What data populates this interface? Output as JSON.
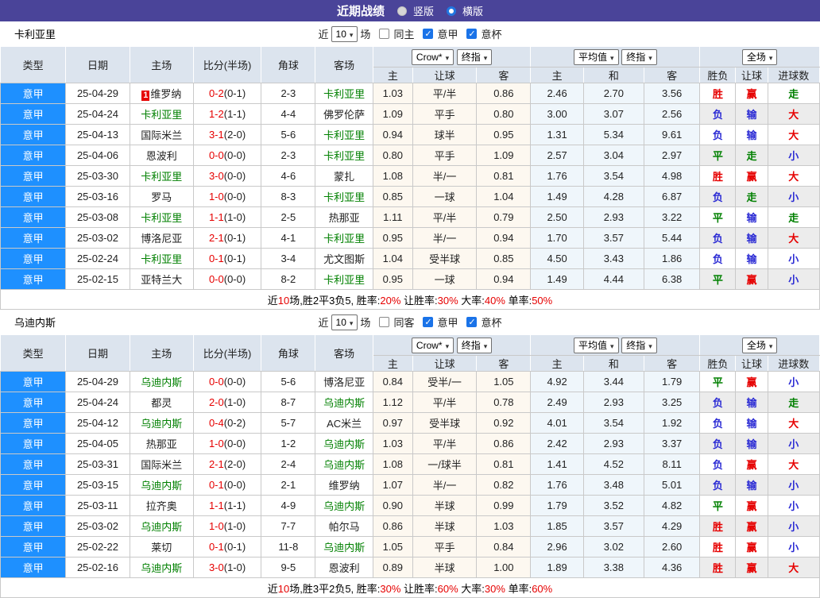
{
  "title_bar": {
    "title": "近期战绩",
    "vertical_label": "竖版",
    "horizontal_label": "横版"
  },
  "table_header": {
    "base_cols": [
      "类型",
      "日期",
      "主场",
      "比分(半场)",
      "角球",
      "客场"
    ],
    "odds_select": "Crow*",
    "odds_final_select": "终指",
    "odds_cols": [
      "主",
      "让球",
      "客"
    ],
    "avg_select": "平均值",
    "avg_final_select": "终指",
    "avg_cols": [
      "主",
      "和",
      "客"
    ],
    "full_select": "全场",
    "result_cols": [
      "胜负",
      "让球",
      "进球数"
    ]
  },
  "result_colors": {
    "胜": "red",
    "赢": "red",
    "大": "red",
    "负": "blue",
    "输": "blue",
    "小": "blue",
    "平": "green",
    "走": "green"
  },
  "row_fields": [
    "league",
    "date",
    "home",
    "home_is_team",
    "home_badge",
    "score_ft",
    "score_ht",
    "corners",
    "away",
    "away_is_team",
    "odds_home",
    "handicap",
    "odds_away",
    "avg_home",
    "avg_draw",
    "avg_away",
    "result",
    "handicap_result",
    "goals_result"
  ],
  "sections": [
    {
      "team": "卡利亚里",
      "controls": {
        "prefix": "近",
        "count": "10",
        "suffix": "场",
        "same": "同主",
        "same_checked": false,
        "league": "意甲",
        "league_checked": true,
        "cup": "意杯",
        "cup_checked": true
      },
      "rows": [
        [
          "意甲",
          "25-04-29",
          "维罗纳",
          0,
          "1",
          "0-2",
          "(0-1)",
          "2-3",
          "卡利亚里",
          1,
          "1.03",
          "平/半",
          "0.86",
          "2.46",
          "2.70",
          "3.56",
          "胜",
          "赢",
          "走"
        ],
        [
          "意甲",
          "25-04-24",
          "卡利亚里",
          1,
          "",
          "1-2",
          "(1-1)",
          "4-4",
          "佛罗伦萨",
          0,
          "1.09",
          "平手",
          "0.80",
          "3.00",
          "3.07",
          "2.56",
          "负",
          "输",
          "大"
        ],
        [
          "意甲",
          "25-04-13",
          "国际米兰",
          0,
          "",
          "3-1",
          "(2-0)",
          "5-6",
          "卡利亚里",
          1,
          "0.94",
          "球半",
          "0.95",
          "1.31",
          "5.34",
          "9.61",
          "负",
          "输",
          "大"
        ],
        [
          "意甲",
          "25-04-06",
          "恩波利",
          0,
          "",
          "0-0",
          "(0-0)",
          "2-3",
          "卡利亚里",
          1,
          "0.80",
          "平手",
          "1.09",
          "2.57",
          "3.04",
          "2.97",
          "平",
          "走",
          "小"
        ],
        [
          "意甲",
          "25-03-30",
          "卡利亚里",
          1,
          "",
          "3-0",
          "(0-0)",
          "4-6",
          "蒙扎",
          0,
          "1.08",
          "半/一",
          "0.81",
          "1.76",
          "3.54",
          "4.98",
          "胜",
          "赢",
          "大"
        ],
        [
          "意甲",
          "25-03-16",
          "罗马",
          0,
          "",
          "1-0",
          "(0-0)",
          "8-3",
          "卡利亚里",
          1,
          "0.85",
          "一球",
          "1.04",
          "1.49",
          "4.28",
          "6.87",
          "负",
          "走",
          "小"
        ],
        [
          "意甲",
          "25-03-08",
          "卡利亚里",
          1,
          "",
          "1-1",
          "(1-0)",
          "2-5",
          "热那亚",
          0,
          "1.11",
          "平/半",
          "0.79",
          "2.50",
          "2.93",
          "3.22",
          "平",
          "输",
          "走"
        ],
        [
          "意甲",
          "25-03-02",
          "博洛尼亚",
          0,
          "",
          "2-1",
          "(0-1)",
          "4-1",
          "卡利亚里",
          1,
          "0.95",
          "半/一",
          "0.94",
          "1.70",
          "3.57",
          "5.44",
          "负",
          "输",
          "大"
        ],
        [
          "意甲",
          "25-02-24",
          "卡利亚里",
          1,
          "",
          "0-1",
          "(0-1)",
          "3-4",
          "尤文图斯",
          0,
          "1.04",
          "受半球",
          "0.85",
          "4.50",
          "3.43",
          "1.86",
          "负",
          "输",
          "小"
        ],
        [
          "意甲",
          "25-02-15",
          "亚特兰大",
          0,
          "",
          "0-0",
          "(0-0)",
          "8-2",
          "卡利亚里",
          1,
          "0.95",
          "一球",
          "0.94",
          "1.49",
          "4.44",
          "6.38",
          "平",
          "赢",
          "小"
        ]
      ],
      "summary_segments": [
        "近",
        "10",
        "场,胜2平3负5, 胜率:",
        "20%",
        " 让胜率:",
        "30%",
        " 大率:",
        "40%",
        " 单率:",
        "50%"
      ]
    },
    {
      "team": "乌迪内斯",
      "controls": {
        "prefix": "近",
        "count": "10",
        "suffix": "场",
        "same": "同客",
        "same_checked": false,
        "league": "意甲",
        "league_checked": true,
        "cup": "意杯",
        "cup_checked": true
      },
      "rows": [
        [
          "意甲",
          "25-04-29",
          "乌迪内斯",
          1,
          "",
          "0-0",
          "(0-0)",
          "5-6",
          "博洛尼亚",
          0,
          "0.84",
          "受半/一",
          "1.05",
          "4.92",
          "3.44",
          "1.79",
          "平",
          "赢",
          "小"
        ],
        [
          "意甲",
          "25-04-24",
          "都灵",
          0,
          "",
          "2-0",
          "(1-0)",
          "8-7",
          "乌迪内斯",
          1,
          "1.12",
          "平/半",
          "0.78",
          "2.49",
          "2.93",
          "3.25",
          "负",
          "输",
          "走"
        ],
        [
          "意甲",
          "25-04-12",
          "乌迪内斯",
          1,
          "",
          "0-4",
          "(0-2)",
          "5-7",
          "AC米兰",
          0,
          "0.97",
          "受半球",
          "0.92",
          "4.01",
          "3.54",
          "1.92",
          "负",
          "输",
          "大"
        ],
        [
          "意甲",
          "25-04-05",
          "热那亚",
          0,
          "",
          "1-0",
          "(0-0)",
          "1-2",
          "乌迪内斯",
          1,
          "1.03",
          "平/半",
          "0.86",
          "2.42",
          "2.93",
          "3.37",
          "负",
          "输",
          "小"
        ],
        [
          "意甲",
          "25-03-31",
          "国际米兰",
          0,
          "",
          "2-1",
          "(2-0)",
          "2-4",
          "乌迪内斯",
          1,
          "1.08",
          "一/球半",
          "0.81",
          "1.41",
          "4.52",
          "8.11",
          "负",
          "赢",
          "大"
        ],
        [
          "意甲",
          "25-03-15",
          "乌迪内斯",
          1,
          "",
          "0-1",
          "(0-0)",
          "2-1",
          "维罗纳",
          0,
          "1.07",
          "半/一",
          "0.82",
          "1.76",
          "3.48",
          "5.01",
          "负",
          "输",
          "小"
        ],
        [
          "意甲",
          "25-03-11",
          "拉齐奥",
          0,
          "",
          "1-1",
          "(1-1)",
          "4-9",
          "乌迪内斯",
          1,
          "0.90",
          "半球",
          "0.99",
          "1.79",
          "3.52",
          "4.82",
          "平",
          "赢",
          "小"
        ],
        [
          "意甲",
          "25-03-02",
          "乌迪内斯",
          1,
          "",
          "1-0",
          "(1-0)",
          "7-7",
          "帕尔马",
          0,
          "0.86",
          "半球",
          "1.03",
          "1.85",
          "3.57",
          "4.29",
          "胜",
          "赢",
          "小"
        ],
        [
          "意甲",
          "25-02-22",
          "莱切",
          0,
          "",
          "0-1",
          "(0-1)",
          "11-8",
          "乌迪内斯",
          1,
          "1.05",
          "平手",
          "0.84",
          "2.96",
          "3.02",
          "2.60",
          "胜",
          "赢",
          "小"
        ],
        [
          "意甲",
          "25-02-16",
          "乌迪内斯",
          1,
          "",
          "3-0",
          "(1-0)",
          "9-5",
          "恩波利",
          0,
          "0.89",
          "半球",
          "1.00",
          "1.89",
          "3.38",
          "4.36",
          "胜",
          "赢",
          "大"
        ]
      ],
      "summary_segments": [
        "近",
        "10",
        "场,胜3平2负5, 胜率:",
        "30%",
        " 让胜率:",
        "60%",
        " 大率:",
        "30%",
        " 单率:",
        "60%"
      ]
    }
  ]
}
